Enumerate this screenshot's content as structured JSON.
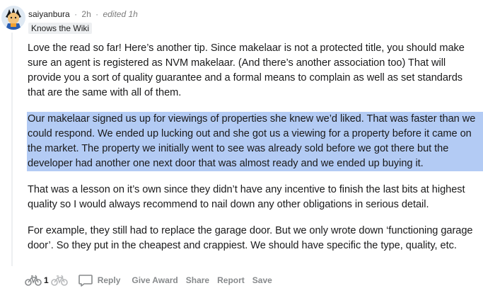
{
  "comment": {
    "username": "saiyanbura",
    "separator": "·",
    "time": "2h",
    "edited": "edited 1h",
    "flair": "Knows the Wiki",
    "paragraphs": [
      "Love the read so far! Here’s another tip. Since makelaar is not a protected title, you should make sure an agent is registered as NVM makelaar. (And there’s another association too) That will provide you a sort of quality guarantee and a formal means to complain as well as set standards that are the same with all of them.",
      "Our makelaar signed us up for viewings of properties she knew we’d liked. That was faster than we could respond. We ended up lucking out and she got us a viewing for a property before it came on the market. The property we initially went to see was already sold before we got there but the developer had another one next door that was almost ready and we ended up buying it.",
      "That was a lesson on it’s own since they didn’t have any incentive to finish the last bits at highest quality so I would always recommend to nail down any other obligations in serious detail.",
      "For example, they still had to replace the garage door. But we only wrote down ‘functioning garage door’. So they put in the cheapest and crappiest. We should have specific the type, quality, etc."
    ]
  },
  "actions": {
    "score": "1",
    "reply": "Reply",
    "give_award": "Give Award",
    "share": "Share",
    "report": "Report",
    "save": "Save"
  },
  "icons": {
    "upvote": "upvote-bike-icon",
    "downvote": "downvote-bike-icon",
    "reply": "comment-bubble-icon"
  }
}
